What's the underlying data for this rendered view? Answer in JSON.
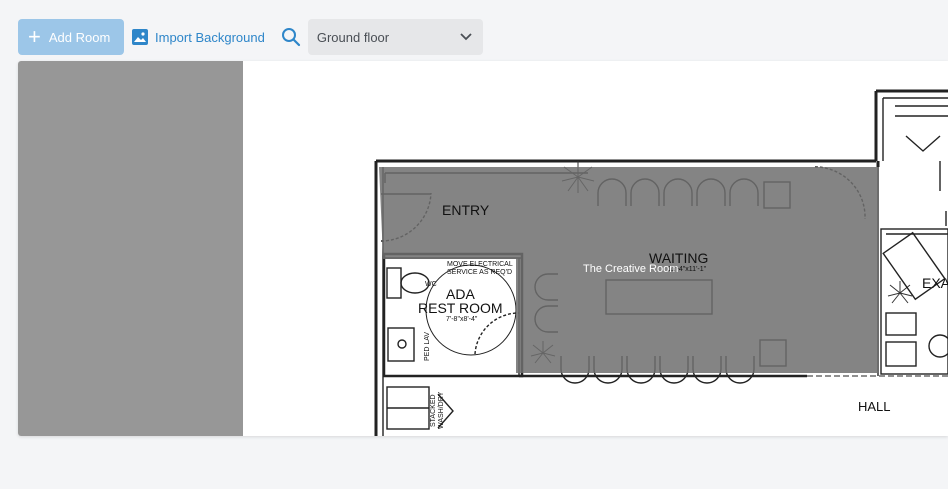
{
  "toolbar": {
    "add_room_label": "Add Room",
    "import_background_label": "Import Background",
    "floor_selected": "Ground floor"
  },
  "floorplan": {
    "room_overlay_name": "The Creative Room",
    "labels": {
      "entry": "ENTRY",
      "waiting": "WAITING",
      "waiting_dims": "11'-4\"x11'-1\"",
      "electrical_line1": "MOVE ELECTRICAL",
      "electrical_line2": "SERVICE AS REQ'D",
      "ada": "ADA",
      "restroom": "REST ROOM",
      "restroom_dims": "7'-8\"x8'-4\"",
      "ped_lav": "PED LAV",
      "stacked": "STACKED",
      "washdry": "WASH/DRY",
      "exam": "EXA",
      "hall": "HALL",
      "wc": "WC"
    }
  },
  "colors": {
    "accent": "#2e86c9",
    "add_button_bg": "#9cc6e8",
    "overlay": "#6e6e6e"
  }
}
